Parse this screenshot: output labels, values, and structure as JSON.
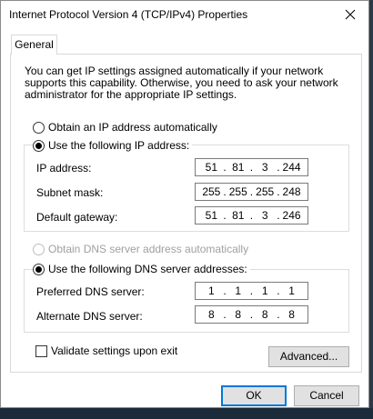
{
  "window": {
    "title": "Internet Protocol Version 4 (TCP/IPv4) Properties"
  },
  "tabs": [
    {
      "label": "General"
    }
  ],
  "general": {
    "description": "You can get IP settings assigned automatically if your network supports this capability. Otherwise, you need to ask your network administrator for the appropriate IP settings.",
    "ip_mode": {
      "auto_label": "Obtain an IP address automatically",
      "manual_label": "Use the following IP address:",
      "selected": "manual"
    },
    "ip_fields": [
      {
        "label": "IP address:",
        "octets": [
          "51",
          "81",
          "3",
          "244"
        ]
      },
      {
        "label": "Subnet mask:",
        "octets": [
          "255",
          "255",
          "255",
          "248"
        ]
      },
      {
        "label": "Default gateway:",
        "octets": [
          "51",
          "81",
          "3",
          "246"
        ]
      }
    ],
    "dns_mode": {
      "auto_label": "Obtain DNS server address automatically",
      "manual_label": "Use the following DNS server addresses:",
      "selected": "manual"
    },
    "dns_fields": [
      {
        "label": "Preferred DNS server:",
        "octets": [
          "1",
          "1",
          "1",
          "1"
        ]
      },
      {
        "label": "Alternate DNS server:",
        "octets": [
          "8",
          "8",
          "8",
          "8"
        ]
      }
    ],
    "validate_label": "Validate settings upon exit",
    "validate_checked": false,
    "advanced_label": "Advanced..."
  },
  "buttons": {
    "ok": "OK",
    "cancel": "Cancel"
  },
  "icons": {
    "close": "close-icon"
  }
}
